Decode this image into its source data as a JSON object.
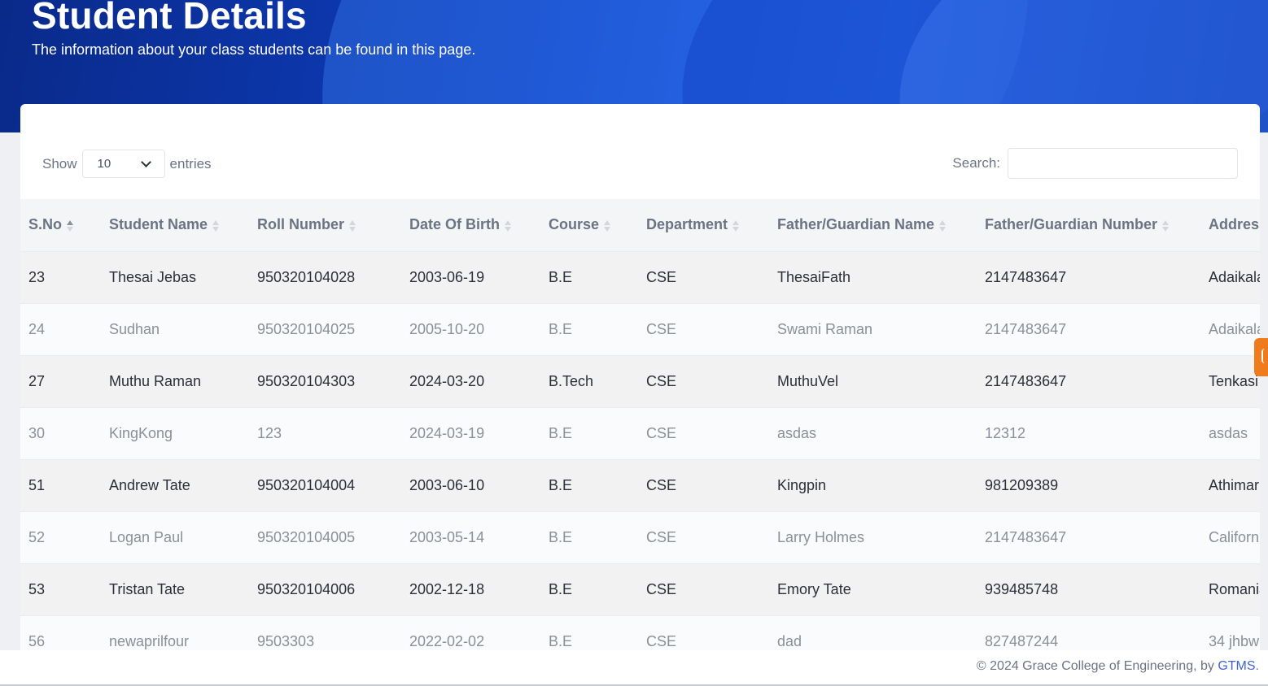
{
  "header": {
    "title": "Student Details",
    "subtitle": "The information about your class students can be found in this page."
  },
  "controls": {
    "show_label": "Show",
    "entries_value": "10",
    "entries_label": "entries",
    "search_label": "Search:",
    "search_value": ""
  },
  "table": {
    "columns": [
      "S.No",
      "Student Name",
      "Roll Number",
      "Date Of Birth",
      "Course",
      "Department",
      "Father/Guardian Name",
      "Father/Guardian Number",
      "Address"
    ],
    "rows": [
      [
        "23",
        "Thesai Jebas",
        "950320104028",
        "2003-06-19",
        "B.E",
        "CSE",
        "ThesaiFath",
        "2147483647",
        "Adaikalapuram"
      ],
      [
        "24",
        "Sudhan",
        "950320104025",
        "2005-10-20",
        "B.E",
        "CSE",
        "Swami Raman",
        "2147483647",
        "Adaikalapuram"
      ],
      [
        "27",
        "Muthu Raman",
        "950320104303",
        "2024-03-20",
        "B.Tech",
        "CSE",
        "MuthuVel",
        "2147483647",
        "Tenkasi"
      ],
      [
        "30",
        "KingKong",
        "123",
        "2024-03-19",
        "B.E",
        "CSE",
        "asdas",
        "12312",
        "asdas"
      ],
      [
        "51",
        "Andrew Tate",
        "950320104004",
        "2003-06-10",
        "B.E",
        "CSE",
        "Kingpin",
        "981209389",
        "Athimari"
      ],
      [
        "52",
        "Logan Paul",
        "950320104005",
        "2003-05-14",
        "B.E",
        "CSE",
        "Larry Holmes",
        "2147483647",
        "California"
      ],
      [
        "53",
        "Tristan Tate",
        "950320104006",
        "2002-12-18",
        "B.E",
        "CSE",
        "Emory Tate",
        "939485748",
        "Romania"
      ],
      [
        "56",
        "newaprilfour",
        "9503303",
        "2022-02-02",
        "B.E",
        "CSE",
        "dad",
        "827487244",
        "34 jhbw"
      ]
    ]
  },
  "footer": {
    "text": "© 2024 Grace College of Engineering, by ",
    "brand": "GTMS",
    "period": "."
  },
  "colors": {
    "accent": "#3d63d8",
    "hero": "#0d3fc2",
    "side_tab": "#f07b1d"
  }
}
